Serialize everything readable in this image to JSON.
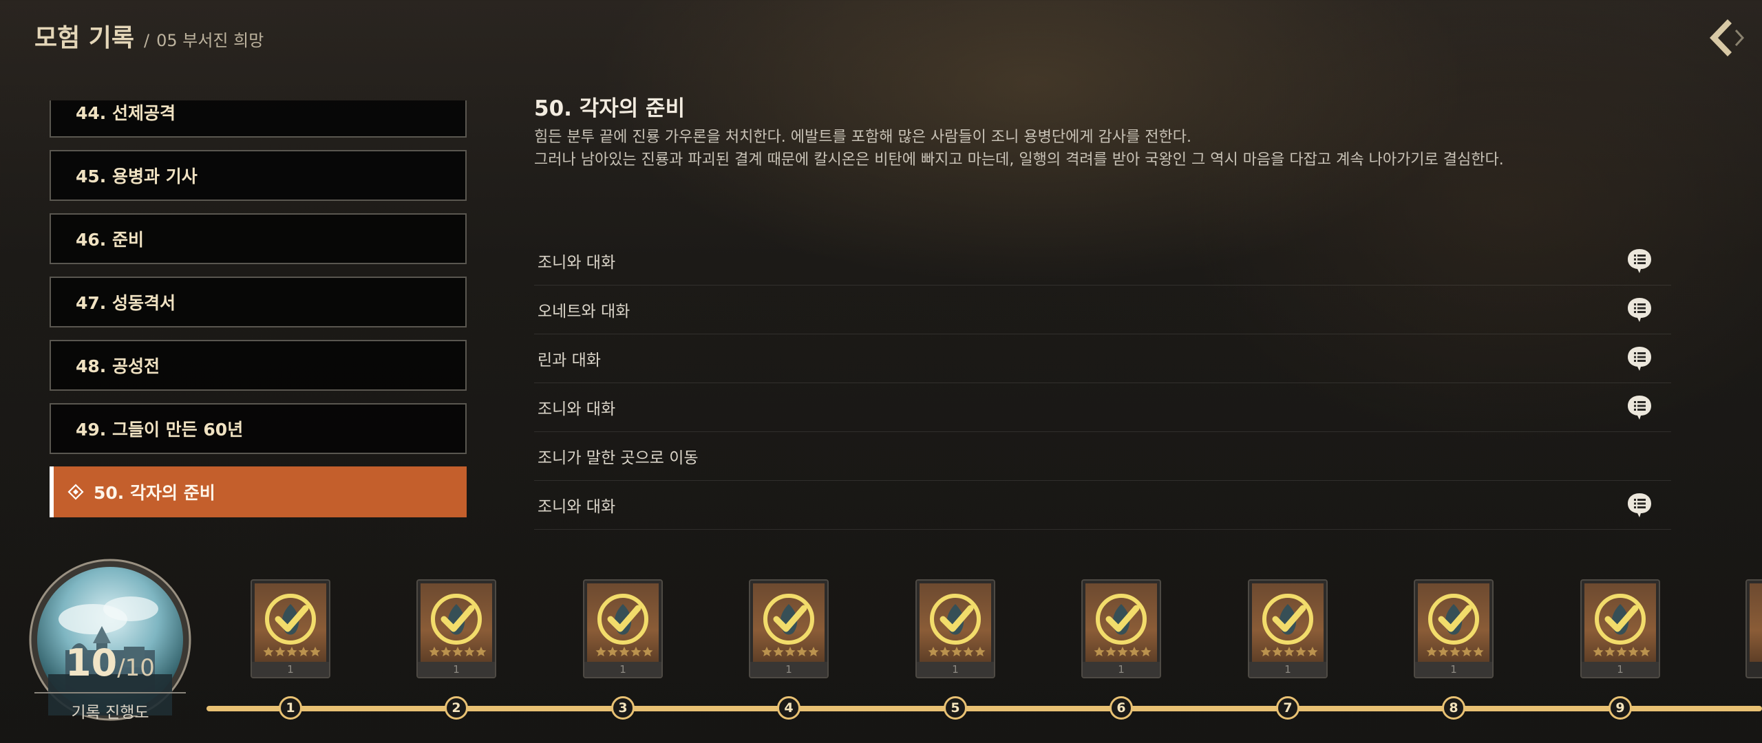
{
  "header": {
    "title": "모험 기록",
    "separator": "/",
    "subtitle": "05 부서진 희망"
  },
  "chapters": [
    {
      "label": "44. 선제공격"
    },
    {
      "label": "45. 용병과 기사"
    },
    {
      "label": "46. 준비"
    },
    {
      "label": "47. 성동격서"
    },
    {
      "label": "48. 공성전"
    },
    {
      "label": "49. 그들이 만든 60년"
    },
    {
      "label": "50. 각자의 준비"
    }
  ],
  "detail": {
    "title": "50. 각자의 준비",
    "desc_line1": "힘든 분투 끝에 진룡 가우론을 처치한다. 에발트를 포함해 많은 사람들이 조니 용병단에게 감사를 전한다.",
    "desc_line2": "그러나 남아있는 진룡과 파괴된 결계 때문에 칼시온은 비탄에 빠지고 마는데, 일행의 격려를 받아 국왕인 그 역시 마음을 다잡고 계속 나아가기로 결심한다."
  },
  "tasks": [
    {
      "label": "조니와 대화",
      "has_dialog": true
    },
    {
      "label": "오네트와 대화",
      "has_dialog": true
    },
    {
      "label": "린과 대화",
      "has_dialog": true
    },
    {
      "label": "조니와 대화",
      "has_dialog": true
    },
    {
      "label": "조니가 말한 곳으로 이동",
      "has_dialog": false
    },
    {
      "label": "조니와 대화",
      "has_dialog": true
    }
  ],
  "progress": {
    "current": "10",
    "separator": "/",
    "total": "10",
    "label": "기록 진행도"
  },
  "rewards": [
    {
      "node": "1",
      "count": "1"
    },
    {
      "node": "2",
      "count": "1"
    },
    {
      "node": "3",
      "count": "1"
    },
    {
      "node": "4",
      "count": "1"
    },
    {
      "node": "5",
      "count": "1"
    },
    {
      "node": "6",
      "count": "1"
    },
    {
      "node": "7",
      "count": "1"
    },
    {
      "node": "8",
      "count": "1"
    },
    {
      "node": "9",
      "count": "1"
    }
  ],
  "colors": {
    "accent": "#c45f2c",
    "timeline": "#e8c173",
    "check": "#f2dc6b"
  },
  "icons": {
    "back": "back-chevron-icon",
    "dialog": "chat-bubble-icon",
    "active_marker": "diamond-icon",
    "card": "checkmark-icon",
    "star": "star-icon"
  }
}
